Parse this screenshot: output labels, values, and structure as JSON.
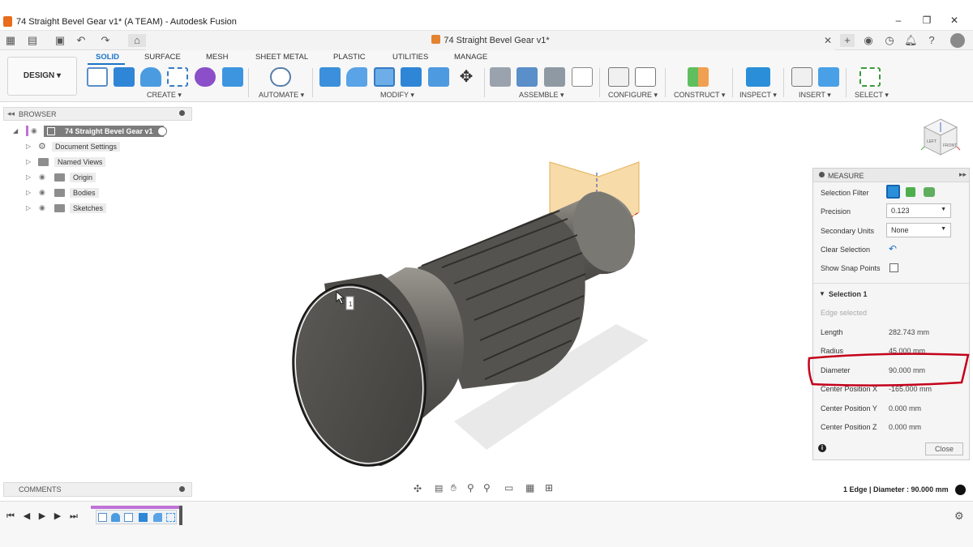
{
  "window": {
    "title": "74 Straight Bevel Gear v1* (A TEAM) - Autodesk Fusion"
  },
  "document_tab": {
    "name": "74 Straight Bevel Gear v1*"
  },
  "workspace": {
    "label": "DESIGN"
  },
  "ribbon": {
    "tabs": [
      "SOLID",
      "SURFACE",
      "MESH",
      "SHEET METAL",
      "PLASTIC",
      "UTILITIES",
      "MANAGE"
    ],
    "active_tab": "SOLID",
    "groups": [
      "CREATE",
      "AUTOMATE",
      "MODIFY",
      "ASSEMBLE",
      "CONFIGURE",
      "CONSTRUCT",
      "INSPECT",
      "INSERT",
      "SELECT"
    ]
  },
  "browser": {
    "header": "BROWSER",
    "root": "74 Straight Bevel Gear v1",
    "items": [
      "Document Settings",
      "Named Views",
      "Origin",
      "Bodies",
      "Sketches"
    ]
  },
  "comments": {
    "label": "COMMENTS"
  },
  "measure": {
    "title": "MEASURE",
    "selection_filter_label": "Selection Filter",
    "precision_label": "Precision",
    "precision_value": "0.123",
    "secondary_units_label": "Secondary Units",
    "secondary_units_value": "None",
    "clear_selection_label": "Clear Selection",
    "show_snap_points_label": "Show Snap Points",
    "selection_header": "Selection 1",
    "selection_hint": "Edge selected",
    "results": [
      {
        "label": "Length",
        "value": "282.743 mm"
      },
      {
        "label": "Radius",
        "value": "45.000 mm"
      },
      {
        "label": "Diameter",
        "value": "90.000 mm"
      },
      {
        "label": "Center Position X",
        "value": "-165.000 mm"
      },
      {
        "label": "Center Position Y",
        "value": "0.000 mm"
      },
      {
        "label": "Center Position Z",
        "value": "0.000 mm"
      }
    ],
    "close_label": "Close"
  },
  "status": {
    "text": "1 Edge | Diameter : 90.000 mm"
  },
  "viewcube": {
    "front": "FRONT",
    "left": "LEFT"
  },
  "edge_marker": "1",
  "colors": {
    "accent": "#1a73c7",
    "highlight": "#c4001a",
    "plane": "#f3c879"
  }
}
